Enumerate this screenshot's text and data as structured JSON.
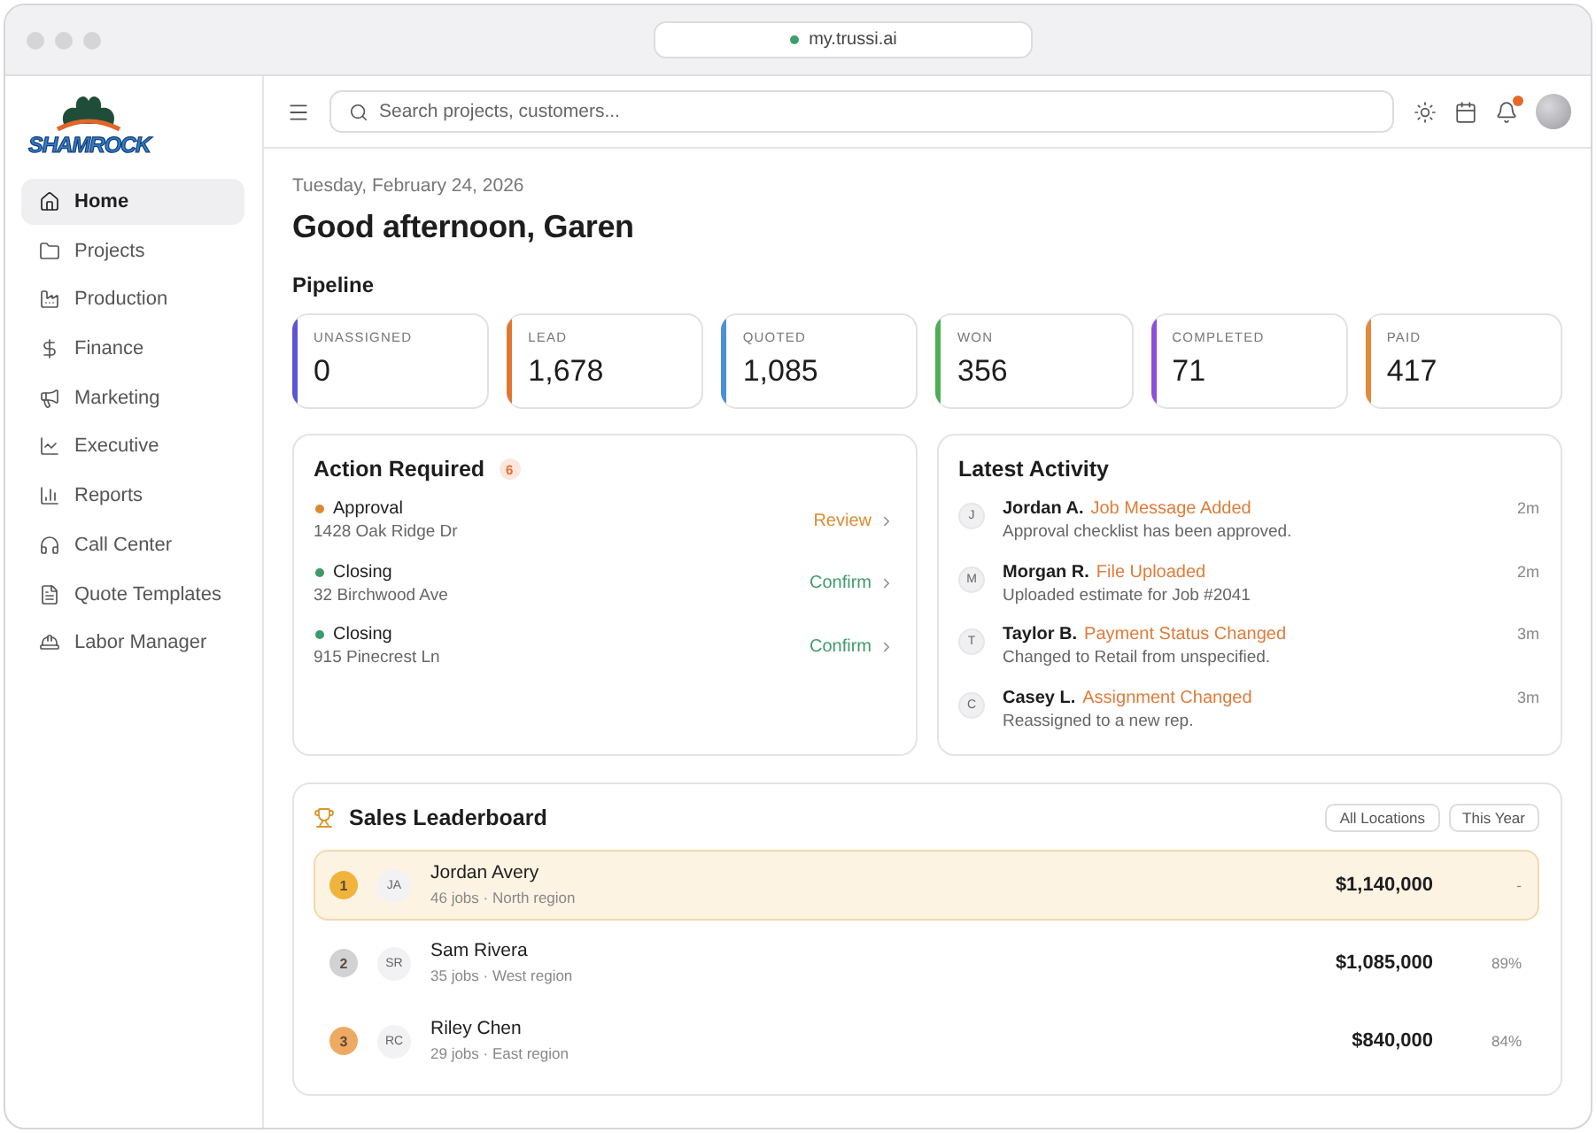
{
  "browser": {
    "url": "my.trussi.ai"
  },
  "logo": {
    "text": "SHAMROCK"
  },
  "sidebar": {
    "items": [
      {
        "label": "Home",
        "selected": true
      },
      {
        "label": "Projects",
        "selected": false
      },
      {
        "label": "Production",
        "selected": false
      },
      {
        "label": "Finance",
        "selected": false
      },
      {
        "label": "Marketing",
        "selected": false
      },
      {
        "label": "Executive",
        "selected": false
      },
      {
        "label": "Reports",
        "selected": false
      },
      {
        "label": "Call Center",
        "selected": false
      },
      {
        "label": "Quote Templates",
        "selected": false
      },
      {
        "label": "Labor Manager",
        "selected": false
      }
    ]
  },
  "topbar": {
    "search": {
      "placeholder": "Search projects, customers..."
    },
    "notifications": {
      "unread": true
    }
  },
  "header": {
    "date": "Tuesday, February 24, 2026",
    "greeting": "Good afternoon, Garen"
  },
  "pipeline": {
    "title": "Pipeline",
    "stages": [
      {
        "label": "UNASSIGNED",
        "value": "0",
        "color": "#5b55d6"
      },
      {
        "label": "LEAD",
        "value": "1,678",
        "color": "#e0762e"
      },
      {
        "label": "QUOTED",
        "value": "1,085",
        "color": "#4a8fd8"
      },
      {
        "label": "WON",
        "value": "356",
        "color": "#4caf55"
      },
      {
        "label": "COMPLETED",
        "value": "71",
        "color": "#8e4fd8"
      },
      {
        "label": "PAID",
        "value": "417",
        "color": "#e3893a"
      }
    ]
  },
  "action_required": {
    "title": "Action Required",
    "count": "6",
    "items": [
      {
        "type": "Approval",
        "address": "1428 Oak Ridge Dr",
        "action": "Review",
        "color": "#dd8a2e"
      },
      {
        "type": "Closing",
        "address": "32 Birchwood Ave",
        "action": "Confirm",
        "color": "#3d9b6b"
      },
      {
        "type": "Closing",
        "address": "915 Pinecrest Ln",
        "action": "Confirm",
        "color": "#3d9b6b"
      }
    ]
  },
  "latest_activity": {
    "title": "Latest Activity",
    "items": [
      {
        "initial": "J",
        "user": "Jordan A.",
        "event": "Job Message Added",
        "detail": "Approval checklist has been approved.",
        "time": "2m"
      },
      {
        "initial": "M",
        "user": "Morgan R.",
        "event": "File Uploaded",
        "detail": "Uploaded estimate for Job #2041",
        "time": "2m"
      },
      {
        "initial": "T",
        "user": "Taylor B.",
        "event": "Payment Status Changed",
        "detail": "Changed to Retail from unspecified.",
        "time": "3m"
      },
      {
        "initial": "C",
        "user": "Casey L.",
        "event": "Assignment Changed",
        "detail": "Reassigned to a new rep.",
        "time": "3m"
      }
    ]
  },
  "leaderboard": {
    "title": "Sales Leaderboard",
    "filters": [
      "All Locations",
      "This Year"
    ],
    "rows": [
      {
        "rank": "1",
        "color": "#f0b43c",
        "initials": "JA",
        "name": "Jordan Avery",
        "meta": "46 jobs · North region",
        "amount": "$1,140,000",
        "share": "-",
        "highlighted": true
      },
      {
        "rank": "2",
        "color": "#d2d2d4",
        "initials": "SR",
        "name": "Sam Rivera",
        "meta": "35 jobs · West region",
        "amount": "$1,085,000",
        "share": "89%",
        "highlighted": false
      },
      {
        "rank": "3",
        "color": "#eeaa62",
        "initials": "RC",
        "name": "Riley Chen",
        "meta": "29 jobs · East region",
        "amount": "$840,000",
        "share": "84%",
        "highlighted": false
      }
    ]
  }
}
